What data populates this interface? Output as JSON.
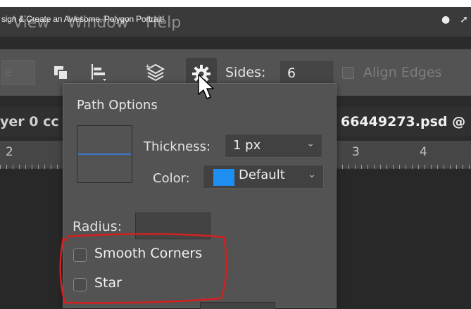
{
  "video": {
    "title": "sign & Create an Awesome, Polygon Portrait!",
    "icons": [
      "clock-icon",
      "share-arrow-icon"
    ]
  },
  "menubar": {
    "items": [
      "View",
      "Window",
      "Help"
    ]
  },
  "toolbar": {
    "prev_field_value": "e",
    "icons": [
      "path-operations-icon",
      "path-alignment-icon",
      "path-arrangement-icon",
      "gear-icon"
    ],
    "sides_label": "Sides:",
    "sides_value": "6",
    "align_edges_label": "Align Edges",
    "align_edges_checked": false
  },
  "document": {
    "tab_left": "yer 0 cc",
    "tab_right": "66449273.psd @",
    "ruler_numbers": [
      "2",
      "3",
      "4"
    ]
  },
  "path_options": {
    "title": "Path Options",
    "thickness_label": "Thickness:",
    "thickness_value": "1 px",
    "color_label": "Color:",
    "color_value": "Default",
    "color_swatch": "#1e8ff0",
    "radius_label": "Radius:",
    "radius_value": "",
    "smooth_corners_label": "Smooth Corners",
    "smooth_corners_checked": false,
    "star_label": "Star",
    "star_checked": false
  },
  "colors": {
    "annotation": "#d42020",
    "accent_blue": "#1e8ff0",
    "panel": "#535353"
  }
}
